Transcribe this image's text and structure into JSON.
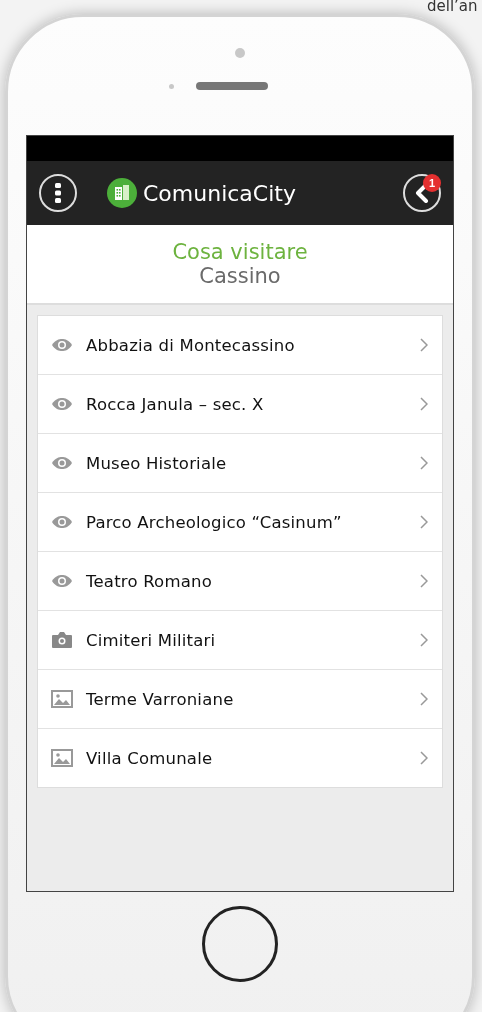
{
  "background": {
    "text": "dell’an"
  },
  "header": {
    "app_name": "ComunicaCity",
    "badge": "1"
  },
  "title": {
    "heading": "Cosa visitare",
    "subheading": "Cassino"
  },
  "items": [
    {
      "label": "Abbazia di Montecassino",
      "kind": "eye"
    },
    {
      "label": "Rocca Janula – sec. X",
      "kind": "eye"
    },
    {
      "label": "Museo Historiale",
      "kind": "eye"
    },
    {
      "label": "Parco Archeologico “Casinum”",
      "kind": "eye"
    },
    {
      "label": "Teatro Romano",
      "kind": "eye"
    },
    {
      "label": "Cimiteri Militari",
      "kind": "camera"
    },
    {
      "label": "Terme Varroniane",
      "kind": "image"
    },
    {
      "label": "Villa Comunale",
      "kind": "image"
    }
  ]
}
